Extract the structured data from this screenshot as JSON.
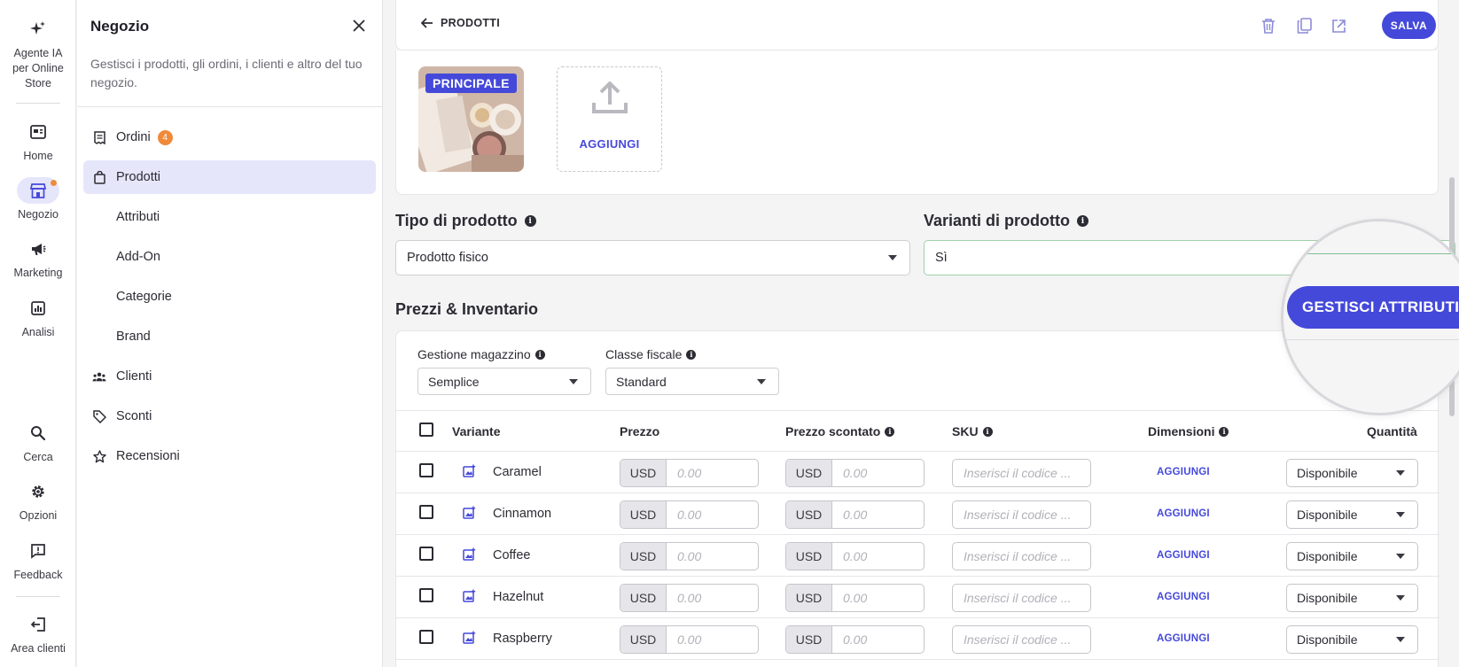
{
  "rail": {
    "items": [
      {
        "label": "Agente IA per Online Store",
        "icon": "sparkle-icon"
      },
      {
        "label": "Home",
        "icon": "dashboard-icon"
      },
      {
        "label": "Negozio",
        "icon": "store-icon"
      },
      {
        "label": "Marketing",
        "icon": "megaphone-icon"
      },
      {
        "label": "Analisi",
        "icon": "chart-icon"
      },
      {
        "label": "Cerca",
        "icon": "search-icon"
      },
      {
        "label": "Opzioni",
        "icon": "gear-icon"
      },
      {
        "label": "Feedback",
        "icon": "feedback-icon"
      },
      {
        "label": "Area clienti",
        "icon": "logout-icon"
      }
    ]
  },
  "panel": {
    "title": "Negozio",
    "description": "Gestisci i prodotti, gli ordini, i clienti e altro del tuo negozio.",
    "items": [
      {
        "label": "Ordini",
        "badge": "4",
        "icon": "receipt-icon"
      },
      {
        "label": "Prodotti",
        "icon": "bag-icon"
      },
      {
        "label": "Attributi"
      },
      {
        "label": "Add-On"
      },
      {
        "label": "Categorie"
      },
      {
        "label": "Brand"
      },
      {
        "label": "Clienti",
        "icon": "users-icon"
      },
      {
        "label": "Sconti",
        "icon": "tag-icon"
      },
      {
        "label": "Recensioni",
        "icon": "star-icon"
      }
    ]
  },
  "topbar": {
    "back_label": "PRODOTTI",
    "save_label": "SALVA"
  },
  "media": {
    "main_label": "PRINCIPALE",
    "add_label": "AGGIUNGI"
  },
  "product_type": {
    "label": "Tipo di prodotto",
    "value": "Prodotto fisico"
  },
  "variants": {
    "label": "Varianti di prodotto",
    "value": "Sì",
    "manage_button": "GESTISCI ATTRIBUTI"
  },
  "pricing": {
    "section_title": "Prezzi & Inventario",
    "stock_label": "Gestione magazzino",
    "stock_value": "Semplice",
    "tax_label": "Classe fiscale",
    "tax_value": "Standard",
    "columns": {
      "variant": "Variante",
      "price": "Prezzo",
      "sale_price": "Prezzo scontato",
      "sku": "SKU",
      "dimensions": "Dimensioni",
      "quantity": "Quantità"
    },
    "currency": "USD",
    "price_placeholder": "0.00",
    "sku_placeholder": "Inserisci il codice ...",
    "dimensions_add": "AGGIUNGI",
    "rows": [
      {
        "name": "Caramel",
        "quantity": "Disponibile"
      },
      {
        "name": "Cinnamon",
        "quantity": "Disponibile"
      },
      {
        "name": "Coffee",
        "quantity": "Disponibile"
      },
      {
        "name": "Hazelnut",
        "quantity": "Disponibile"
      },
      {
        "name": "Raspberry",
        "quantity": "Disponibile"
      }
    ]
  },
  "colors": {
    "accent": "#4549d9",
    "badge": "#ef8a3b",
    "active_bg": "#e6e6fb"
  }
}
